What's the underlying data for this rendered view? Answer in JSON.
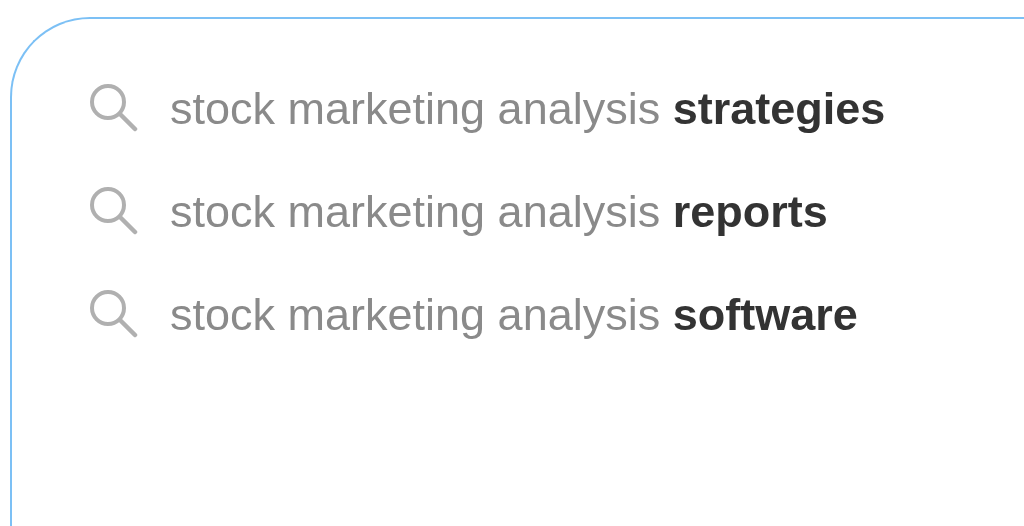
{
  "suggestions": [
    {
      "text": "stock marketing analysis **strategies**"
    },
    {
      "text": "stock marketing analysis **reports**"
    },
    {
      "text": "stock marketing analysis **software**"
    }
  ]
}
